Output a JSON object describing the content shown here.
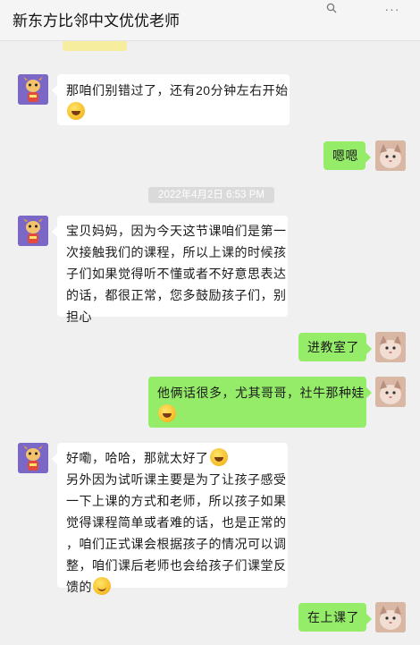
{
  "header": {
    "title": "新东方比邻中文优优老师",
    "search_icon": "search-icon",
    "more_icon": "more-icon"
  },
  "messages": [
    {
      "sender": "teacher",
      "lines": [
        "那咱们别错过了，还有20分钟左右开始"
      ],
      "emoji_line": "grin"
    },
    {
      "sender": "me",
      "lines": [
        "嗯嗯"
      ]
    },
    {
      "timestamp": "2022年4月2日 6:53 PM"
    },
    {
      "sender": "teacher",
      "lines": [
        "宝贝妈妈，因为今天这节课咱们是第一",
        "次接触我们的课程，所以上课的时候孩",
        "子们如果觉得听不懂或者不好意思表达",
        "的话，都很正常，您多鼓励孩子们，别",
        "担心"
      ]
    },
    {
      "sender": "me",
      "lines": [
        "进教室了"
      ]
    },
    {
      "sender": "me",
      "lines": [
        "他俩话很多，尤其哥哥，社牛那种娃"
      ],
      "emoji_line": "laugh-cry"
    },
    {
      "sender": "teacher",
      "lines": [
        "好嘞，哈哈，那就太好了",
        "另外因为试听课主要是为了让孩子感受",
        "一下上课的方式和老师，所以孩子如果",
        "觉得课程简单或者难的话，也是正常的",
        "，咱们正式课会根据孩子的情况可以调",
        "整，咱们课后老师也会给孩子们课堂反",
        "馈的"
      ],
      "emojis": [
        "grin",
        "smile"
      ]
    },
    {
      "sender": "me",
      "lines": [
        "在上课了"
      ]
    }
  ],
  "colors": {
    "chat_bg": "#f0f0f0",
    "incoming_bubble": "#ffffff",
    "outgoing_bubble": "#95ec69",
    "teacher_avatar_bg": "#7b68c6"
  }
}
